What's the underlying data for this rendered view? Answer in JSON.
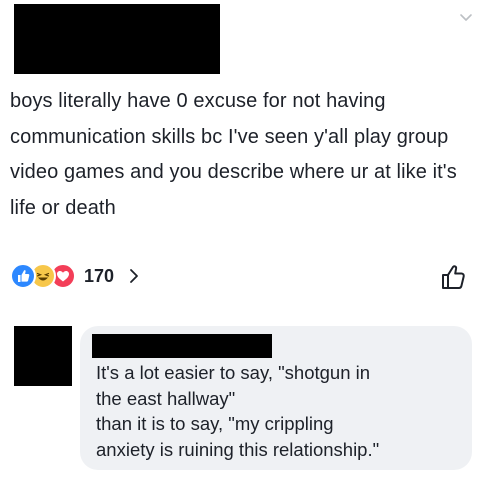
{
  "post": {
    "text": "boys literally have 0 excuse for not having communication skills bc I've seen y'all play group video games and you describe where ur at like it's life or death",
    "reactions": {
      "icons": [
        "like-icon",
        "haha-icon",
        "love-icon"
      ],
      "count": "170"
    }
  },
  "comment": {
    "lines": [
      "It's a lot easier to say, \"shotgun in",
      "the east hallway\"",
      "than it is to say, \"my crippling",
      "anxiety is ruining this relationship.\""
    ]
  },
  "colors": {
    "like": "#2d88ff",
    "haha": "#f7c74a",
    "love": "#f33e58",
    "bubble": "#eff1f4",
    "text": "#1d2129"
  }
}
